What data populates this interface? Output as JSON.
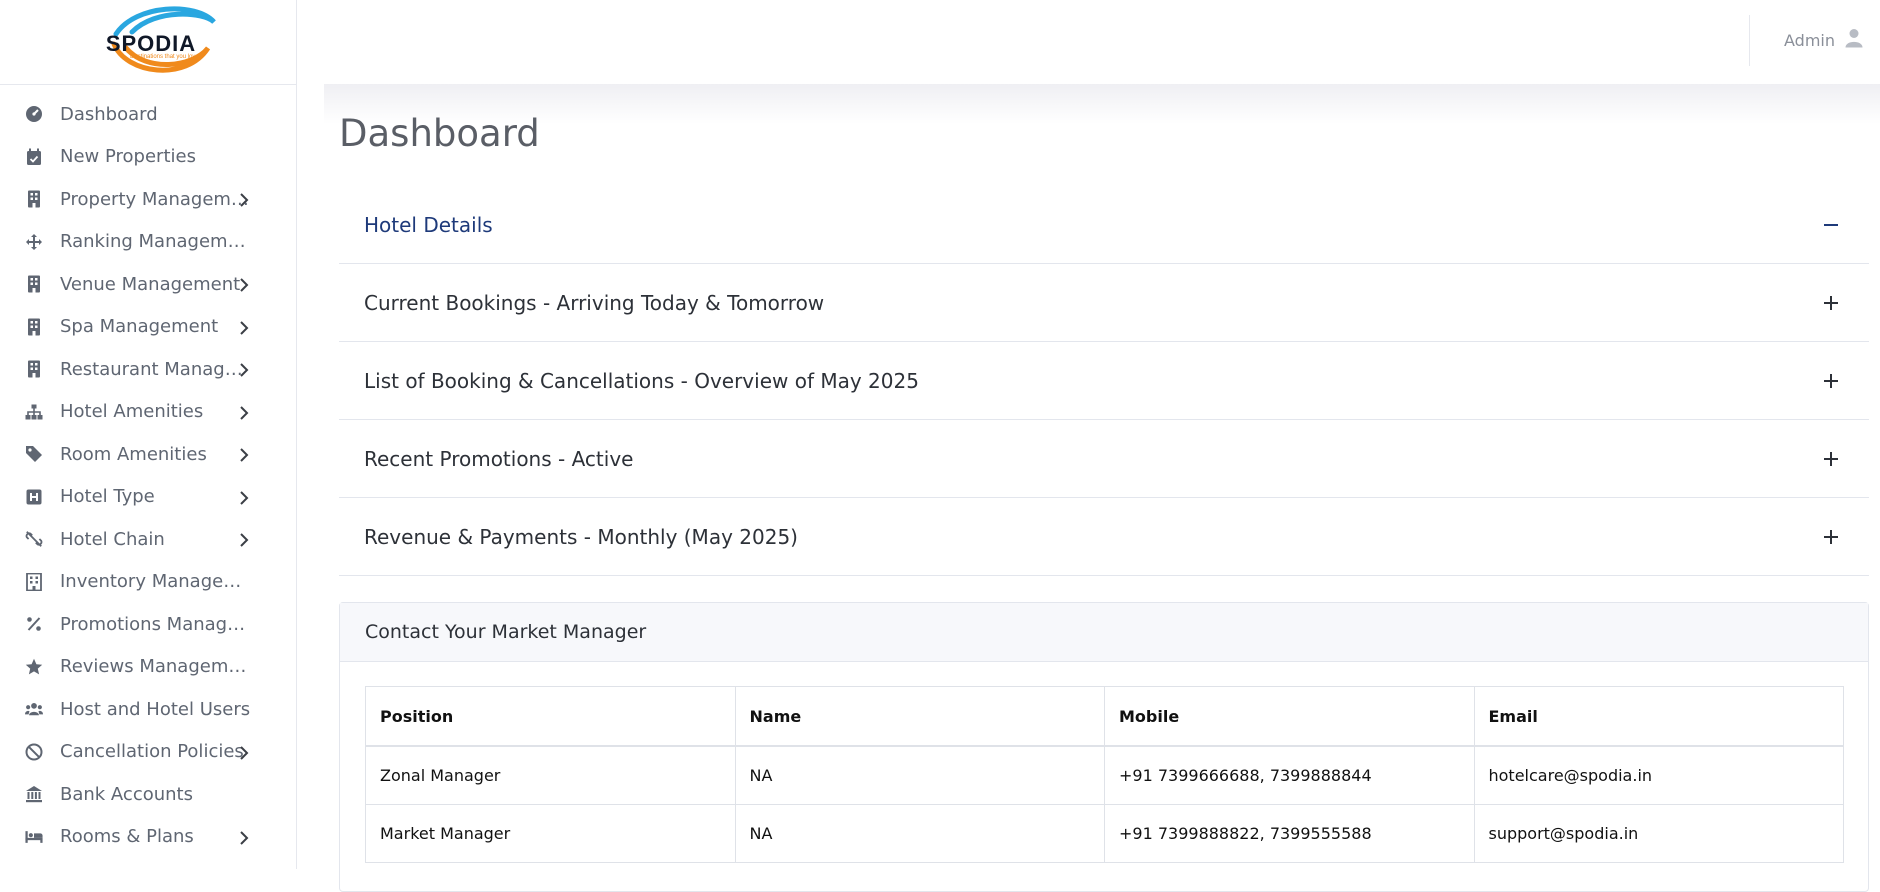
{
  "logo": {
    "word": "SPODIA",
    "tagline": "Destinations that you love"
  },
  "sidebar": {
    "items": [
      {
        "label": "Dashboard",
        "icon": "dashboard-icon",
        "chevron": false
      },
      {
        "label": "New Properties",
        "icon": "calendar-check-icon",
        "chevron": false
      },
      {
        "label": "Property Management",
        "icon": "building-icon",
        "chevron": true
      },
      {
        "label": "Ranking Management",
        "icon": "arrows-move-icon",
        "chevron": false
      },
      {
        "label": "Venue Management",
        "icon": "building-icon",
        "chevron": true
      },
      {
        "label": "Spa Management",
        "icon": "building-icon",
        "chevron": true
      },
      {
        "label": "Restaurant Management",
        "icon": "building-icon",
        "chevron": true
      },
      {
        "label": "Hotel Amenities",
        "icon": "sitemap-icon",
        "chevron": true
      },
      {
        "label": "Room Amenities",
        "icon": "tag-icon",
        "chevron": true
      },
      {
        "label": "Hotel Type",
        "icon": "hotel-h-icon",
        "chevron": true
      },
      {
        "label": "Hotel Chain",
        "icon": "unlink-icon",
        "chevron": true
      },
      {
        "label": "Inventory Management",
        "icon": "building-grid-icon",
        "chevron": false
      },
      {
        "label": "Promotions Management",
        "icon": "percent-icon",
        "chevron": false
      },
      {
        "label": "Reviews Management",
        "icon": "star-icon",
        "chevron": false
      },
      {
        "label": "Host and Hotel Users",
        "icon": "users-icon",
        "chevron": false
      },
      {
        "label": "Cancellation Policies",
        "icon": "ban-icon",
        "chevron": true
      },
      {
        "label": "Bank Accounts",
        "icon": "bank-icon",
        "chevron": false
      },
      {
        "label": "Rooms & Plans",
        "icon": "bed-icon",
        "chevron": true
      }
    ]
  },
  "header": {
    "user_name": "Admin"
  },
  "main": {
    "title": "Dashboard",
    "accordion": [
      {
        "label": "Hotel Details",
        "open": true
      },
      {
        "label": "Current Bookings - Arriving Today & Tomorrow",
        "open": false
      },
      {
        "label": "List of Booking & Cancellations - Overview of May 2025",
        "open": false
      },
      {
        "label": "Recent Promotions - Active",
        "open": false
      },
      {
        "label": "Revenue & Payments - Monthly (May 2025)",
        "open": false
      }
    ],
    "contact_card": {
      "title": "Contact Your Market Manager",
      "columns": [
        "Position",
        "Name",
        "Mobile",
        "Email"
      ],
      "rows": [
        [
          "Zonal Manager",
          "NA",
          "+91 7399666688, 7399888844",
          "hotelcare@spodia.in"
        ],
        [
          "Market Manager",
          "NA",
          "+91 7399888822, 7399555588",
          "support@spodia.in"
        ]
      ]
    }
  },
  "colors": {
    "accent_open": "#1e3a7a",
    "text_muted": "#5f6672",
    "brand_orange": "#f08a1c",
    "brand_blue": "#2aa7e0"
  }
}
